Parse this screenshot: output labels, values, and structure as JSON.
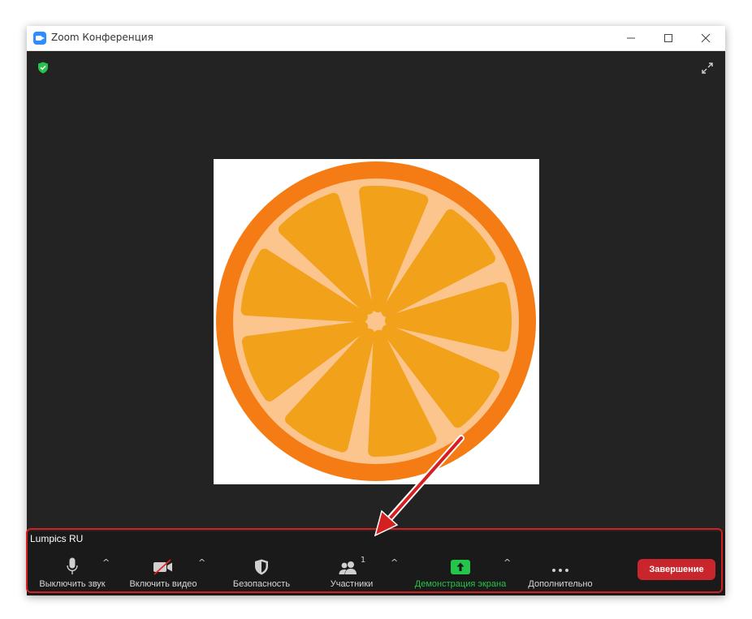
{
  "window": {
    "title": "Zoom Конференция",
    "controls": [
      "minimize",
      "maximize",
      "close"
    ]
  },
  "meeting": {
    "participant_name": "Lumpics RU",
    "security_status": "encrypted"
  },
  "toolbar": {
    "mute_label": "Выключить звук",
    "video_label": "Включить видео",
    "security_label": "Безопасность",
    "participants_label": "Участники",
    "participants_count": "1",
    "share_label": "Демонстрация экрана",
    "more_label": "Дополнительно",
    "end_label": "Завершение"
  },
  "colors": {
    "accent_green": "#25c44a",
    "end_red": "#c8262c",
    "highlight_red": "#d42020",
    "orange_rind": "#f57c14",
    "orange_pith": "#fcc58d",
    "orange_segment": "#f2a11a"
  },
  "icons": [
    "app-icon",
    "shield-icon",
    "fullscreen-icon",
    "mic-icon",
    "video-off-icon",
    "security-shield-icon",
    "participants-icon",
    "share-screen-icon",
    "more-icon"
  ]
}
